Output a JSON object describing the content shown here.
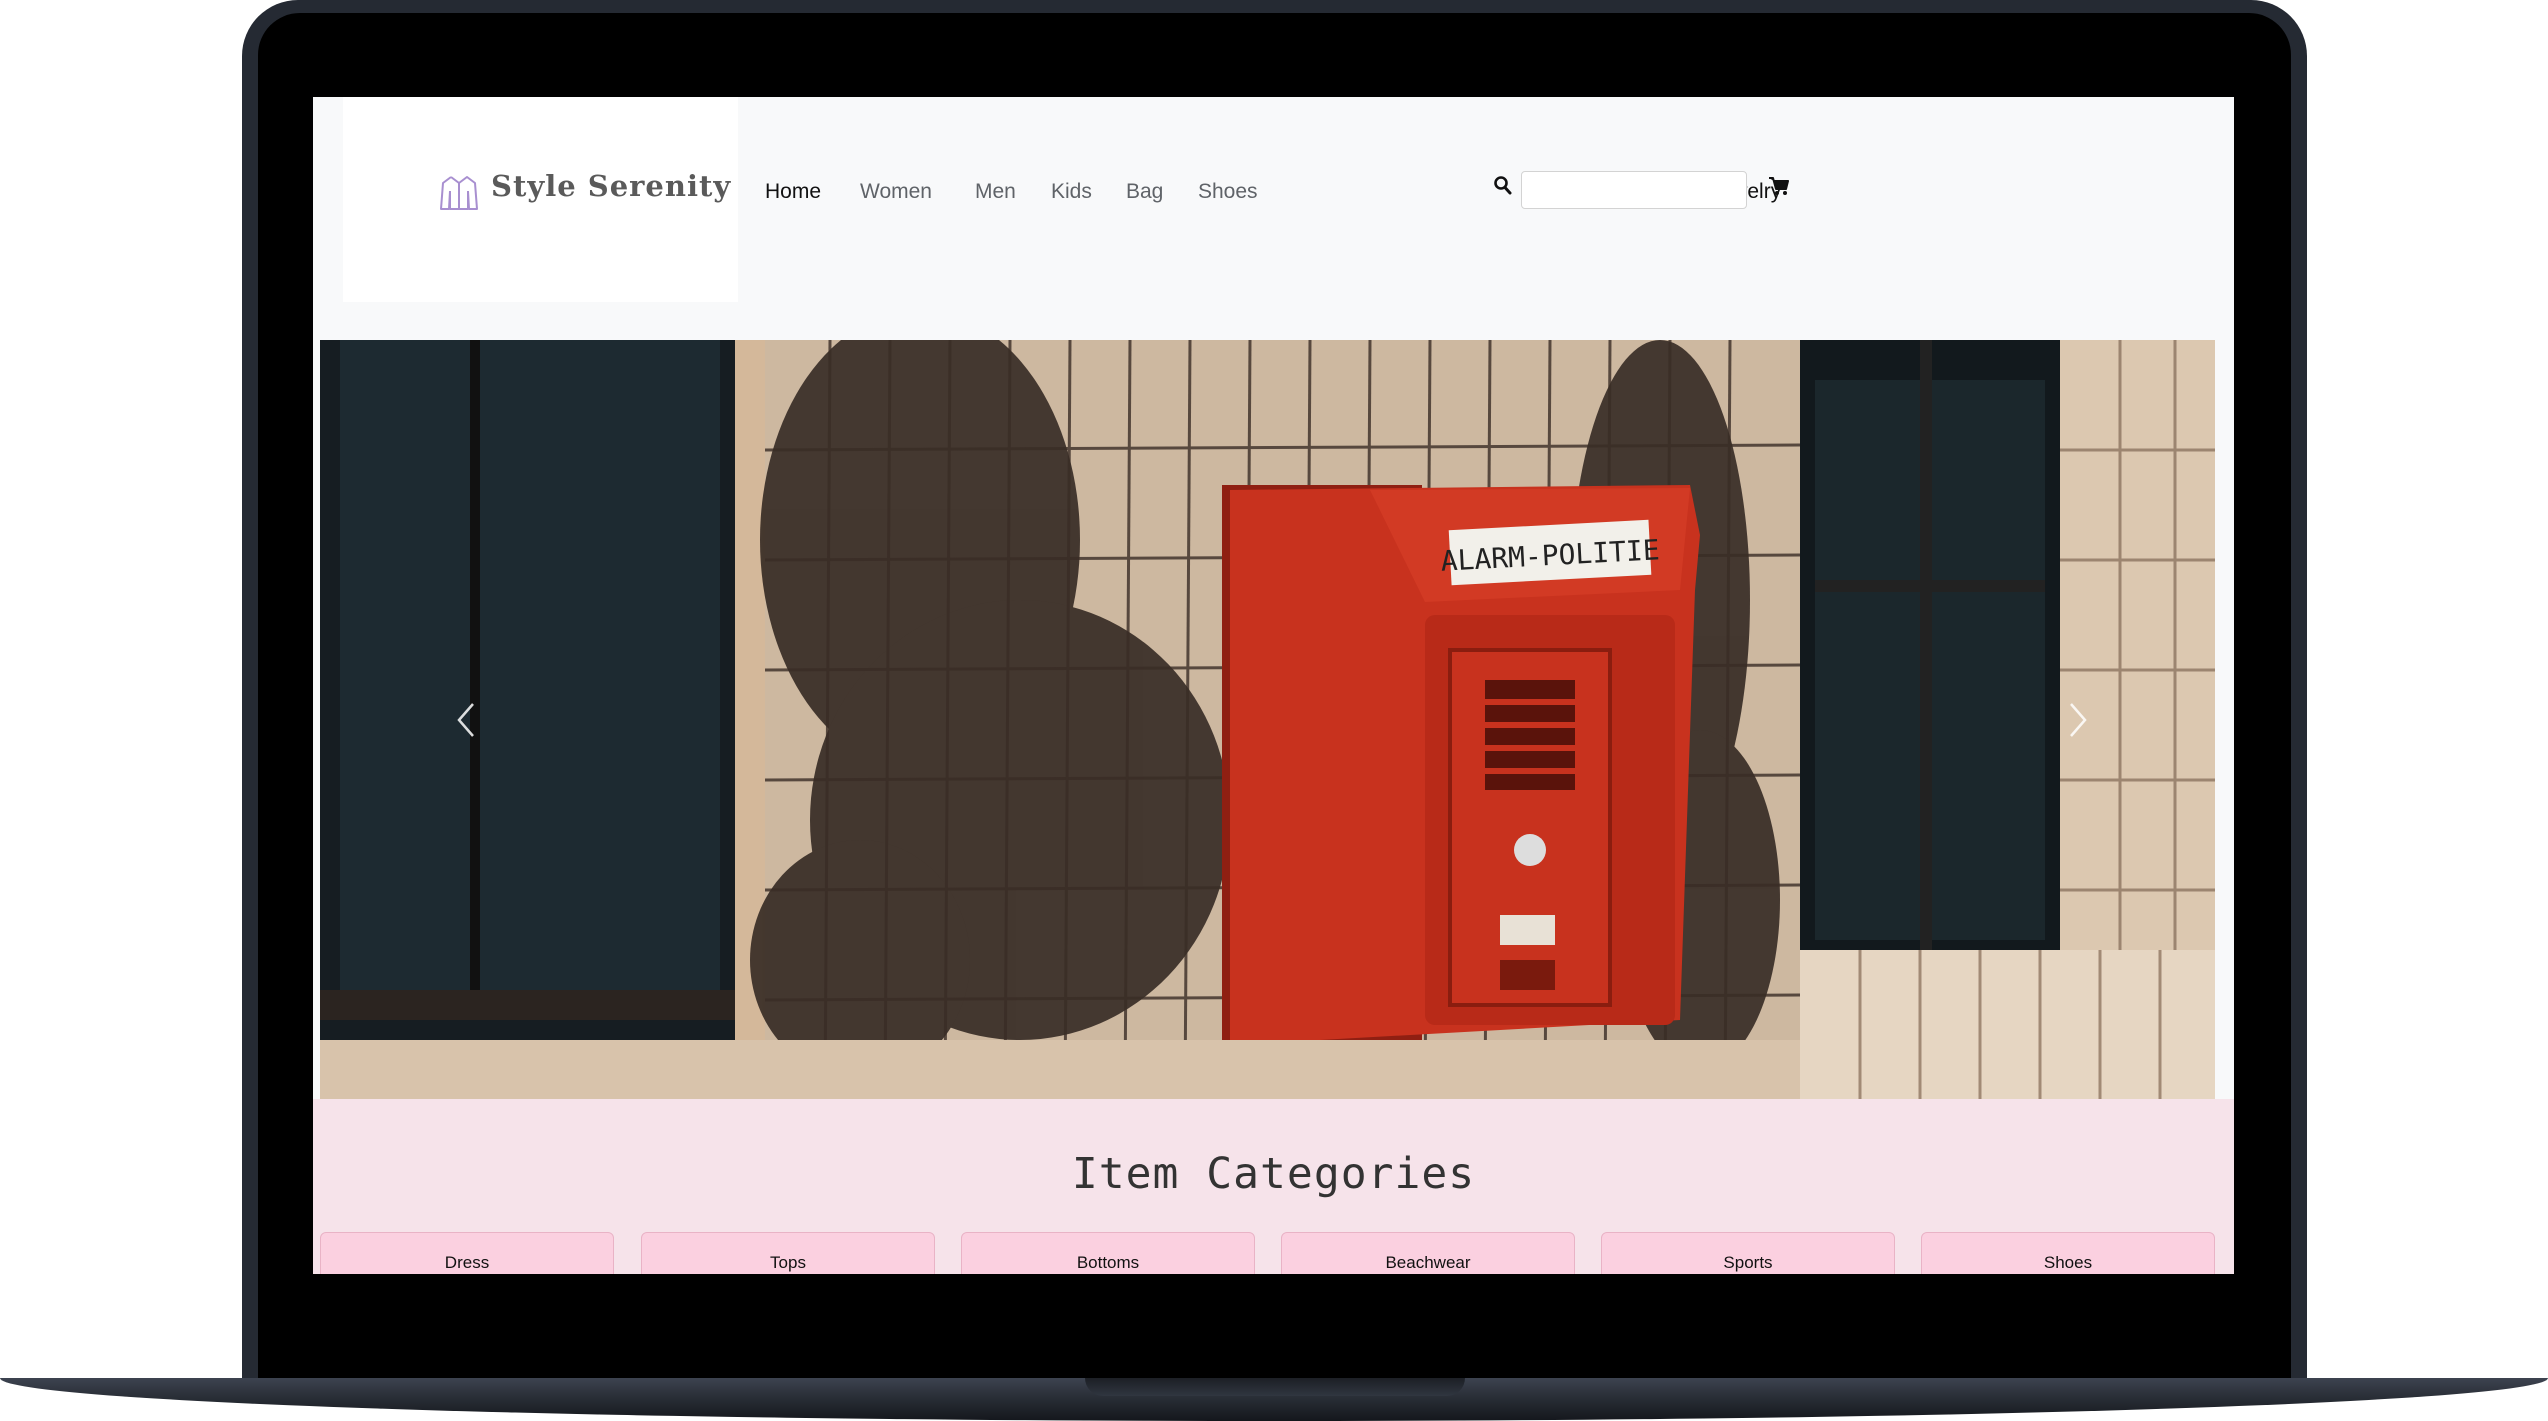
{
  "brand": {
    "name": "Style Serenity",
    "logo_icon": "jacket-icon"
  },
  "nav": {
    "links": [
      "Home",
      "Women",
      "Men",
      "Kids",
      "Bag",
      "Shoes",
      "Accessories/Jewelry"
    ],
    "active": "Home"
  },
  "search": {
    "placeholder": "",
    "value": "",
    "icon": "search-icon"
  },
  "cart": {
    "icon": "cart-icon"
  },
  "hero": {
    "sign_text": "ALARM-POLITIE",
    "prev_icon": "chevron-left-icon",
    "next_icon": "chevron-right-icon"
  },
  "categories": {
    "title": "Item Categories",
    "items": [
      "Dress",
      "Tops",
      "Bottoms",
      "Beachwear",
      "Sports",
      "Shoes"
    ]
  },
  "colors": {
    "navbar_bg": "#f8f9fa",
    "categories_bg": "#f6e3ea",
    "category_button_bg": "#fbd0e0",
    "alarm_box": "#c8321e"
  }
}
